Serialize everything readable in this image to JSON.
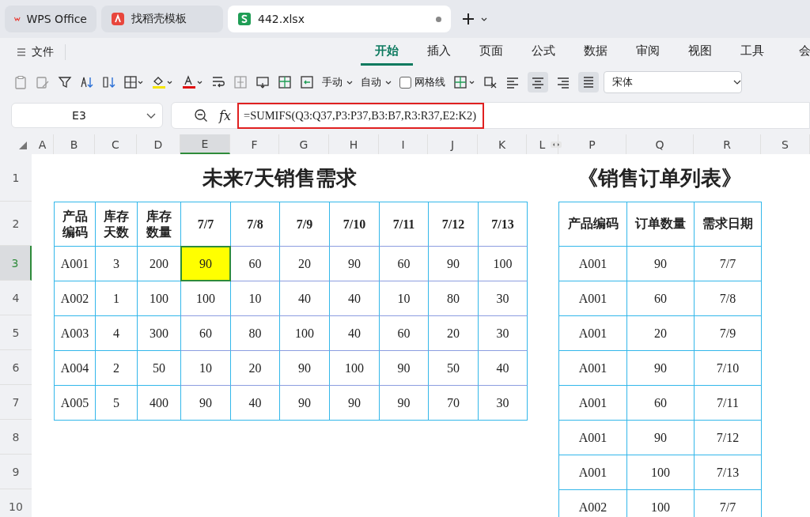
{
  "app_tabs": [
    {
      "label": "WPS Office",
      "kind": "home",
      "selected": false,
      "modified": false
    },
    {
      "label": "找稻壳模板",
      "kind": "template",
      "selected": false,
      "modified": false
    },
    {
      "label": "442.xlsx",
      "kind": "sheet",
      "selected": true,
      "modified": true
    }
  ],
  "file_menu": "文件",
  "ribbon_tabs": [
    {
      "label": "开始",
      "selected": true
    },
    {
      "label": "插入",
      "selected": false
    },
    {
      "label": "页面",
      "selected": false
    },
    {
      "label": "公式",
      "selected": false
    },
    {
      "label": "数据",
      "selected": false
    },
    {
      "label": "审阅",
      "selected": false
    },
    {
      "label": "视图",
      "selected": false
    },
    {
      "label": "工具",
      "selected": false
    },
    {
      "label": "会",
      "selected": false
    }
  ],
  "toolbar": {
    "row_height_mode": "手动",
    "col_width_mode": "自动",
    "gridlines": {
      "label": "网格线",
      "checked": false
    },
    "font": "宋体"
  },
  "name_box": "E3",
  "function_label": "fx",
  "formula": "=SUMIFS(Q3:Q37,P3:P37,B3:B7,R3:R37,E2:K2)",
  "columns": [
    {
      "label": "A",
      "selected": false
    },
    {
      "label": "B",
      "selected": false
    },
    {
      "label": "C",
      "selected": false
    },
    {
      "label": "D",
      "selected": false
    },
    {
      "label": "E",
      "selected": true
    },
    {
      "label": "F",
      "selected": false
    },
    {
      "label": "G",
      "selected": false
    },
    {
      "label": "H",
      "selected": false
    },
    {
      "label": "I",
      "selected": false
    },
    {
      "label": "J",
      "selected": false
    },
    {
      "label": "K",
      "selected": false
    },
    {
      "label": "L",
      "selected": false
    },
    {
      "label": "P",
      "selected": false
    },
    {
      "label": "Q",
      "selected": false
    },
    {
      "label": "R",
      "selected": false
    },
    {
      "label": "S",
      "selected": false
    }
  ],
  "row_numbers": [
    {
      "label": "1",
      "selected": false
    },
    {
      "label": "2",
      "selected": false
    },
    {
      "label": "3",
      "selected": true
    },
    {
      "label": "4",
      "selected": false
    },
    {
      "label": "5",
      "selected": false
    },
    {
      "label": "6",
      "selected": false
    },
    {
      "label": "7",
      "selected": false
    },
    {
      "label": "8",
      "selected": false
    },
    {
      "label": "9",
      "selected": false
    },
    {
      "label": "10",
      "selected": false
    }
  ],
  "demand_table": {
    "title": "未来7天销售需求",
    "headers": [
      "产品编码",
      "库存天数",
      "库存数量",
      "7/7",
      "7/8",
      "7/9",
      "7/10",
      "7/11",
      "7/12",
      "7/13"
    ],
    "rows": [
      {
        "code": "A001",
        "days": "3",
        "stock": "200",
        "values": [
          {
            "text": "90",
            "selected": true,
            "color": "#ffff00"
          },
          {
            "text": "60",
            "selected": false
          },
          {
            "text": "20",
            "selected": false
          },
          {
            "text": "90",
            "selected": false
          },
          {
            "text": "60",
            "selected": false
          },
          {
            "text": "90",
            "selected": false
          },
          {
            "text": "100",
            "selected": false
          }
        ]
      },
      {
        "code": "A002",
        "days": "1",
        "stock": "100",
        "values": [
          {
            "text": "100",
            "selected": false
          },
          {
            "text": "10",
            "selected": false
          },
          {
            "text": "40",
            "selected": false
          },
          {
            "text": "40",
            "selected": false
          },
          {
            "text": "10",
            "selected": false
          },
          {
            "text": "80",
            "selected": false
          },
          {
            "text": "30",
            "selected": false
          }
        ]
      },
      {
        "code": "A003",
        "days": "4",
        "stock": "300",
        "values": [
          {
            "text": "60",
            "selected": false
          },
          {
            "text": "80",
            "selected": false
          },
          {
            "text": "100",
            "selected": false
          },
          {
            "text": "40",
            "selected": false
          },
          {
            "text": "60",
            "selected": false
          },
          {
            "text": "20",
            "selected": false
          },
          {
            "text": "30",
            "selected": false
          }
        ]
      },
      {
        "code": "A004",
        "days": "2",
        "stock": "50",
        "values": [
          {
            "text": "10",
            "selected": false
          },
          {
            "text": "20",
            "selected": false
          },
          {
            "text": "90",
            "selected": false
          },
          {
            "text": "100",
            "selected": false
          },
          {
            "text": "90",
            "selected": false
          },
          {
            "text": "50",
            "selected": false
          },
          {
            "text": "40",
            "selected": false
          }
        ]
      },
      {
        "code": "A005",
        "days": "5",
        "stock": "400",
        "values": [
          {
            "text": "90",
            "selected": false
          },
          {
            "text": "40",
            "selected": false
          },
          {
            "text": "90",
            "selected": false
          },
          {
            "text": "90",
            "selected": false
          },
          {
            "text": "90",
            "selected": false
          },
          {
            "text": "70",
            "selected": false
          },
          {
            "text": "30",
            "selected": false
          }
        ]
      }
    ]
  },
  "order_table": {
    "title": "《销售订单列表》",
    "headers": [
      "产品编码",
      "订单数量",
      "需求日期"
    ],
    "rows": [
      [
        "A001",
        "90",
        "7/7"
      ],
      [
        "A001",
        "60",
        "7/8"
      ],
      [
        "A001",
        "20",
        "7/9"
      ],
      [
        "A001",
        "90",
        "7/10"
      ],
      [
        "A001",
        "60",
        "7/11"
      ],
      [
        "A001",
        "90",
        "7/12"
      ],
      [
        "A001",
        "100",
        "7/13"
      ],
      [
        "A002",
        "100",
        "7/7"
      ]
    ]
  }
}
